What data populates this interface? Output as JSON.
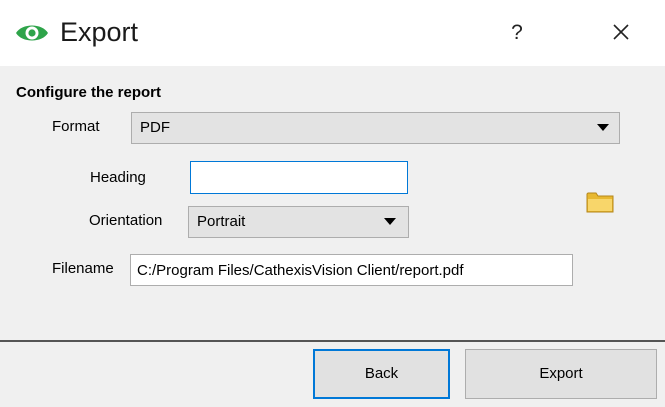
{
  "window": {
    "title": "Export",
    "help_label": "?",
    "icon": "eye-icon",
    "close_icon": "close-icon"
  },
  "section": {
    "title": "Configure the report"
  },
  "form": {
    "format_label": "Format",
    "format_value": "PDF",
    "heading_label": "Heading",
    "heading_value": "",
    "orientation_label": "Orientation",
    "orientation_value": "Portrait",
    "filename_label": "Filename",
    "filename_value": "C:/Program Files/CathexisVision Client/report.pdf",
    "browse_icon": "folder-icon"
  },
  "buttons": {
    "back_label": "Back",
    "export_label": "Export"
  },
  "colors": {
    "accent": "#0078d7",
    "brand_green": "#2ea44a",
    "panel_bg": "#f0f0f0"
  }
}
